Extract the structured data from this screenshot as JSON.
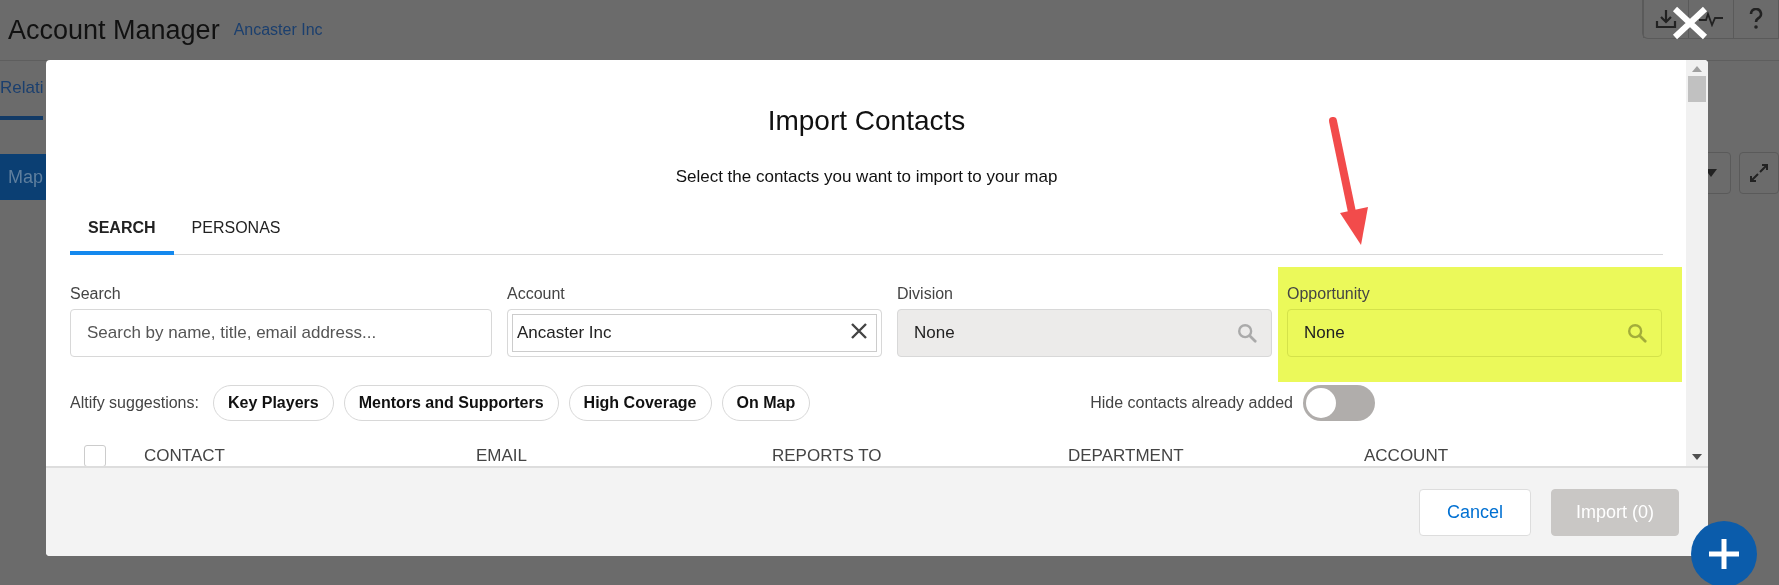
{
  "app_header": {
    "title": "Account Manager",
    "account_link": "Ancaster Inc"
  },
  "background": {
    "tab": "Relati",
    "map_button": "Map"
  },
  "modal": {
    "title": "Import Contacts",
    "subtitle": "Select the contacts you want to import to your map",
    "tabs": [
      {
        "label": "SEARCH",
        "selected": true
      },
      {
        "label": "PERSONAS",
        "selected": false
      }
    ],
    "fields": [
      {
        "label": "Search",
        "kind": "text",
        "placeholder": "Search by name, title, email address...",
        "disabled": false,
        "highlighted": false
      },
      {
        "label": "Account",
        "kind": "clearable",
        "value": "Ancaster Inc",
        "disabled": false,
        "highlighted": false
      },
      {
        "label": "Division",
        "kind": "lookup",
        "value": "None",
        "disabled": true,
        "highlighted": false
      },
      {
        "label": "Opportunity",
        "kind": "lookup",
        "value": "None",
        "disabled": false,
        "highlighted": true
      }
    ],
    "suggestions_label": "Altify suggestions:",
    "suggestions": [
      "Key Players",
      "Mentors and Supporters",
      "High Coverage",
      "On Map"
    ],
    "hide_toggle": {
      "label": "Hide contacts already added",
      "on": false
    },
    "table": {
      "select_all_checked": false,
      "columns": [
        "CONTACT",
        "EMAIL",
        "REPORTS TO",
        "DEPARTMENT",
        "ACCOUNT"
      ]
    },
    "buttons": [
      {
        "label": "Cancel",
        "kind": "neutral",
        "disabled": false
      },
      {
        "label": "Import (0)",
        "kind": "brand",
        "disabled": true
      }
    ]
  }
}
